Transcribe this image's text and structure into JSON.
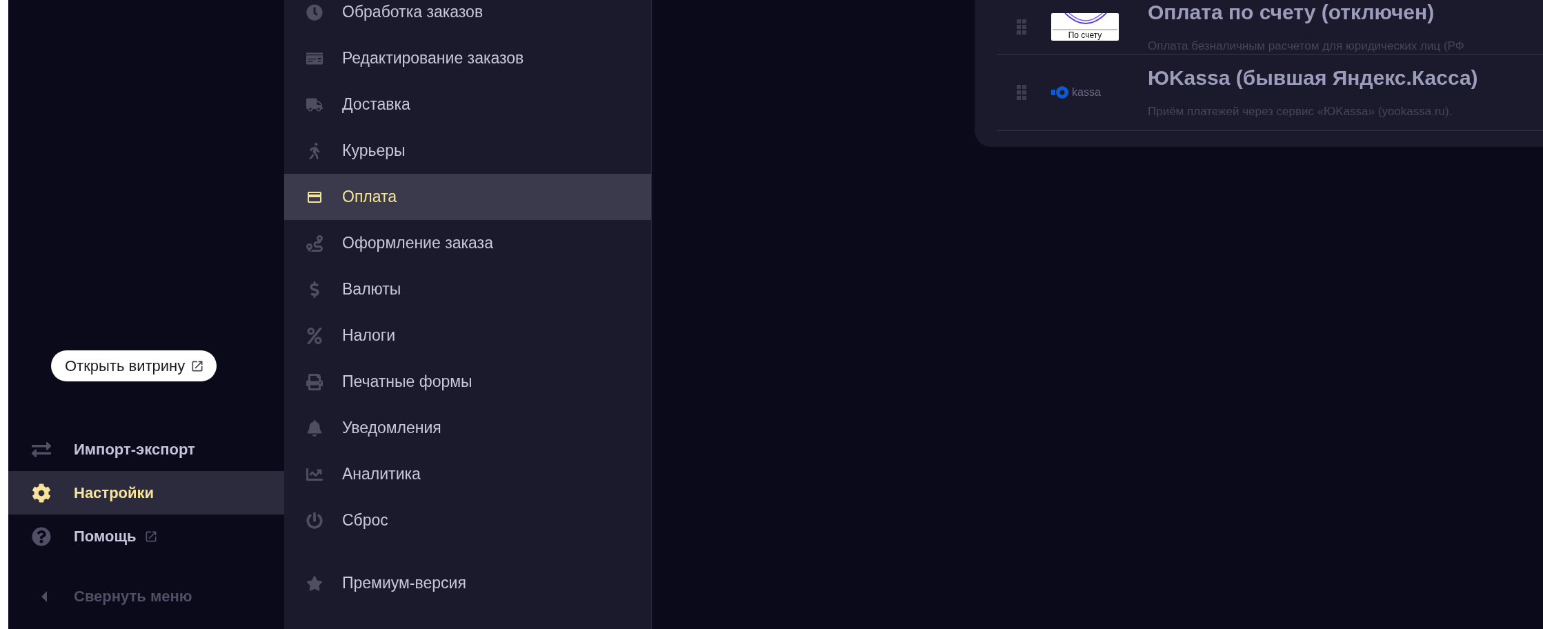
{
  "sidebar": {
    "storefront_button": {
      "label": "Открыть витрину"
    },
    "items": [
      {
        "label": "Импорт-экспорт",
        "selected": false,
        "external": false
      },
      {
        "label": "Настройки",
        "selected": true,
        "external": false
      },
      {
        "label": "Помощь",
        "selected": false,
        "external": true
      }
    ],
    "collapse": {
      "label": "Свернуть меню"
    }
  },
  "settings_menu": {
    "items": [
      {
        "label": "Обработка заказов",
        "selected": false
      },
      {
        "label": "Редактирование заказов",
        "selected": false
      },
      {
        "label": "Доставка",
        "selected": false
      },
      {
        "label": "Курьеры",
        "selected": false
      },
      {
        "label": "Оплата",
        "selected": true
      },
      {
        "label": "Оформление заказа",
        "selected": false
      },
      {
        "label": "Валюты",
        "selected": false
      },
      {
        "label": "Налоги",
        "selected": false
      },
      {
        "label": "Печатные формы",
        "selected": false
      },
      {
        "label": "Уведомления",
        "selected": false
      },
      {
        "label": "Аналитика",
        "selected": false
      },
      {
        "label": "Сброс",
        "selected": false
      }
    ],
    "premium": {
      "label": "Премиум-версия",
      "selected": false
    }
  },
  "payment_methods": [
    {
      "kind": "invoice",
      "logo_text": "По счету",
      "title": "Оплата по счету (отключен)",
      "description": "Оплата безналичным расчетом для юридических лиц (РФ"
    },
    {
      "kind": "yookassa",
      "logo_text": "kassa",
      "title": "ЮKassa (бывшая Яндекс.Касса)",
      "description": "Приём платежей через сервис «ЮKassa» (yookassa.ru)."
    }
  ]
}
